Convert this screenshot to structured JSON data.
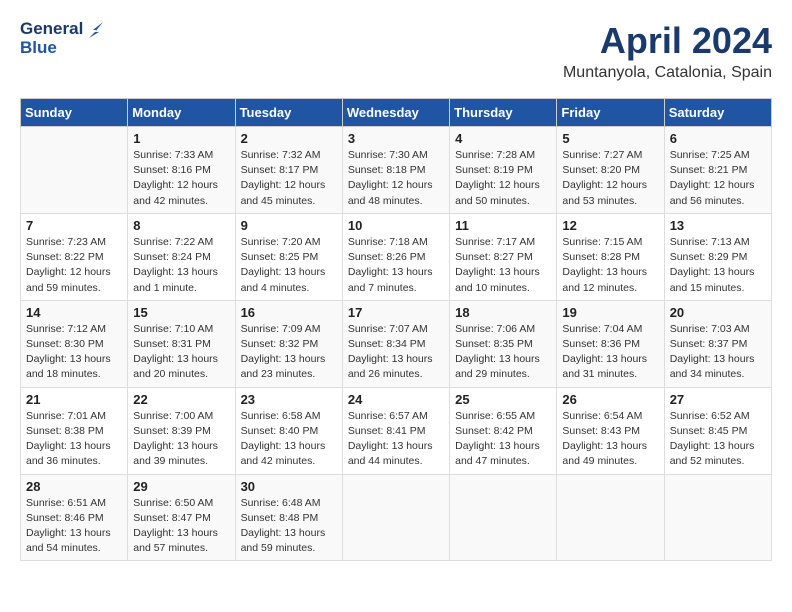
{
  "header": {
    "logo_general": "General",
    "logo_blue": "Blue",
    "title": "April 2024",
    "subtitle": "Muntanyola, Catalonia, Spain"
  },
  "columns": [
    "Sunday",
    "Monday",
    "Tuesday",
    "Wednesday",
    "Thursday",
    "Friday",
    "Saturday"
  ],
  "weeks": [
    [
      {
        "day": "",
        "info": ""
      },
      {
        "day": "1",
        "info": "Sunrise: 7:33 AM\nSunset: 8:16 PM\nDaylight: 12 hours\nand 42 minutes."
      },
      {
        "day": "2",
        "info": "Sunrise: 7:32 AM\nSunset: 8:17 PM\nDaylight: 12 hours\nand 45 minutes."
      },
      {
        "day": "3",
        "info": "Sunrise: 7:30 AM\nSunset: 8:18 PM\nDaylight: 12 hours\nand 48 minutes."
      },
      {
        "day": "4",
        "info": "Sunrise: 7:28 AM\nSunset: 8:19 PM\nDaylight: 12 hours\nand 50 minutes."
      },
      {
        "day": "5",
        "info": "Sunrise: 7:27 AM\nSunset: 8:20 PM\nDaylight: 12 hours\nand 53 minutes."
      },
      {
        "day": "6",
        "info": "Sunrise: 7:25 AM\nSunset: 8:21 PM\nDaylight: 12 hours\nand 56 minutes."
      }
    ],
    [
      {
        "day": "7",
        "info": "Sunrise: 7:23 AM\nSunset: 8:22 PM\nDaylight: 12 hours\nand 59 minutes."
      },
      {
        "day": "8",
        "info": "Sunrise: 7:22 AM\nSunset: 8:24 PM\nDaylight: 13 hours\nand 1 minute."
      },
      {
        "day": "9",
        "info": "Sunrise: 7:20 AM\nSunset: 8:25 PM\nDaylight: 13 hours\nand 4 minutes."
      },
      {
        "day": "10",
        "info": "Sunrise: 7:18 AM\nSunset: 8:26 PM\nDaylight: 13 hours\nand 7 minutes."
      },
      {
        "day": "11",
        "info": "Sunrise: 7:17 AM\nSunset: 8:27 PM\nDaylight: 13 hours\nand 10 minutes."
      },
      {
        "day": "12",
        "info": "Sunrise: 7:15 AM\nSunset: 8:28 PM\nDaylight: 13 hours\nand 12 minutes."
      },
      {
        "day": "13",
        "info": "Sunrise: 7:13 AM\nSunset: 8:29 PM\nDaylight: 13 hours\nand 15 minutes."
      }
    ],
    [
      {
        "day": "14",
        "info": "Sunrise: 7:12 AM\nSunset: 8:30 PM\nDaylight: 13 hours\nand 18 minutes."
      },
      {
        "day": "15",
        "info": "Sunrise: 7:10 AM\nSunset: 8:31 PM\nDaylight: 13 hours\nand 20 minutes."
      },
      {
        "day": "16",
        "info": "Sunrise: 7:09 AM\nSunset: 8:32 PM\nDaylight: 13 hours\nand 23 minutes."
      },
      {
        "day": "17",
        "info": "Sunrise: 7:07 AM\nSunset: 8:34 PM\nDaylight: 13 hours\nand 26 minutes."
      },
      {
        "day": "18",
        "info": "Sunrise: 7:06 AM\nSunset: 8:35 PM\nDaylight: 13 hours\nand 29 minutes."
      },
      {
        "day": "19",
        "info": "Sunrise: 7:04 AM\nSunset: 8:36 PM\nDaylight: 13 hours\nand 31 minutes."
      },
      {
        "day": "20",
        "info": "Sunrise: 7:03 AM\nSunset: 8:37 PM\nDaylight: 13 hours\nand 34 minutes."
      }
    ],
    [
      {
        "day": "21",
        "info": "Sunrise: 7:01 AM\nSunset: 8:38 PM\nDaylight: 13 hours\nand 36 minutes."
      },
      {
        "day": "22",
        "info": "Sunrise: 7:00 AM\nSunset: 8:39 PM\nDaylight: 13 hours\nand 39 minutes."
      },
      {
        "day": "23",
        "info": "Sunrise: 6:58 AM\nSunset: 8:40 PM\nDaylight: 13 hours\nand 42 minutes."
      },
      {
        "day": "24",
        "info": "Sunrise: 6:57 AM\nSunset: 8:41 PM\nDaylight: 13 hours\nand 44 minutes."
      },
      {
        "day": "25",
        "info": "Sunrise: 6:55 AM\nSunset: 8:42 PM\nDaylight: 13 hours\nand 47 minutes."
      },
      {
        "day": "26",
        "info": "Sunrise: 6:54 AM\nSunset: 8:43 PM\nDaylight: 13 hours\nand 49 minutes."
      },
      {
        "day": "27",
        "info": "Sunrise: 6:52 AM\nSunset: 8:45 PM\nDaylight: 13 hours\nand 52 minutes."
      }
    ],
    [
      {
        "day": "28",
        "info": "Sunrise: 6:51 AM\nSunset: 8:46 PM\nDaylight: 13 hours\nand 54 minutes."
      },
      {
        "day": "29",
        "info": "Sunrise: 6:50 AM\nSunset: 8:47 PM\nDaylight: 13 hours\nand 57 minutes."
      },
      {
        "day": "30",
        "info": "Sunrise: 6:48 AM\nSunset: 8:48 PM\nDaylight: 13 hours\nand 59 minutes."
      },
      {
        "day": "",
        "info": ""
      },
      {
        "day": "",
        "info": ""
      },
      {
        "day": "",
        "info": ""
      },
      {
        "day": "",
        "info": ""
      }
    ]
  ]
}
